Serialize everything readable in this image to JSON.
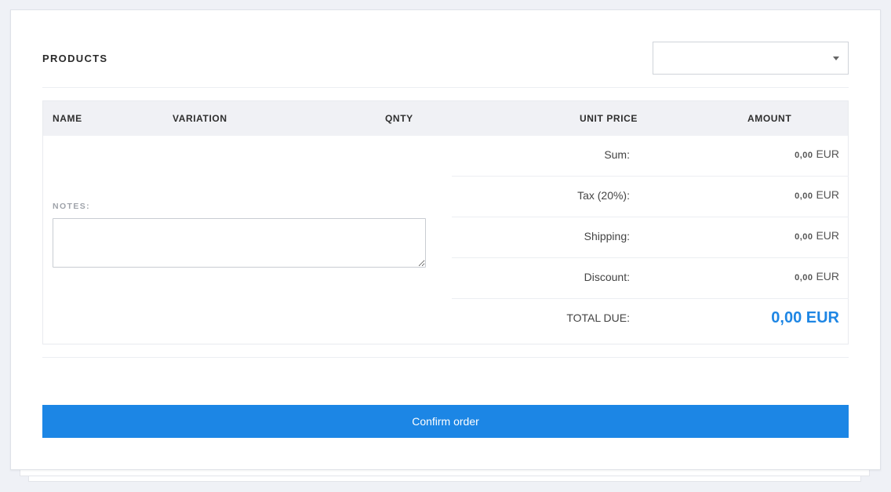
{
  "products": {
    "title": "PRODUCTS",
    "select": {
      "selected": ""
    }
  },
  "table": {
    "headers": {
      "name": "NAME",
      "variation": "VARIATION",
      "qnty": "QNTY",
      "unit_price": "UNIT PRICE",
      "amount": "AMOUNT"
    }
  },
  "notes": {
    "label": "NOTES:",
    "value": "",
    "placeholder": ""
  },
  "totals": {
    "currency": "EUR",
    "rows": [
      {
        "label": "Sum:",
        "value": "0,00"
      },
      {
        "label": "Tax (20%):",
        "value": "0,00"
      },
      {
        "label": "Shipping:",
        "value": "0,00"
      },
      {
        "label": "Discount:",
        "value": "0,00"
      }
    ],
    "total_due": {
      "label": "TOTAL DUE:",
      "value": "0,00 EUR"
    }
  },
  "actions": {
    "confirm_label": "Confirm order"
  },
  "colors": {
    "accent": "#1c86e5",
    "background": "#eff1f6",
    "header_row": "#f0f1f5"
  }
}
